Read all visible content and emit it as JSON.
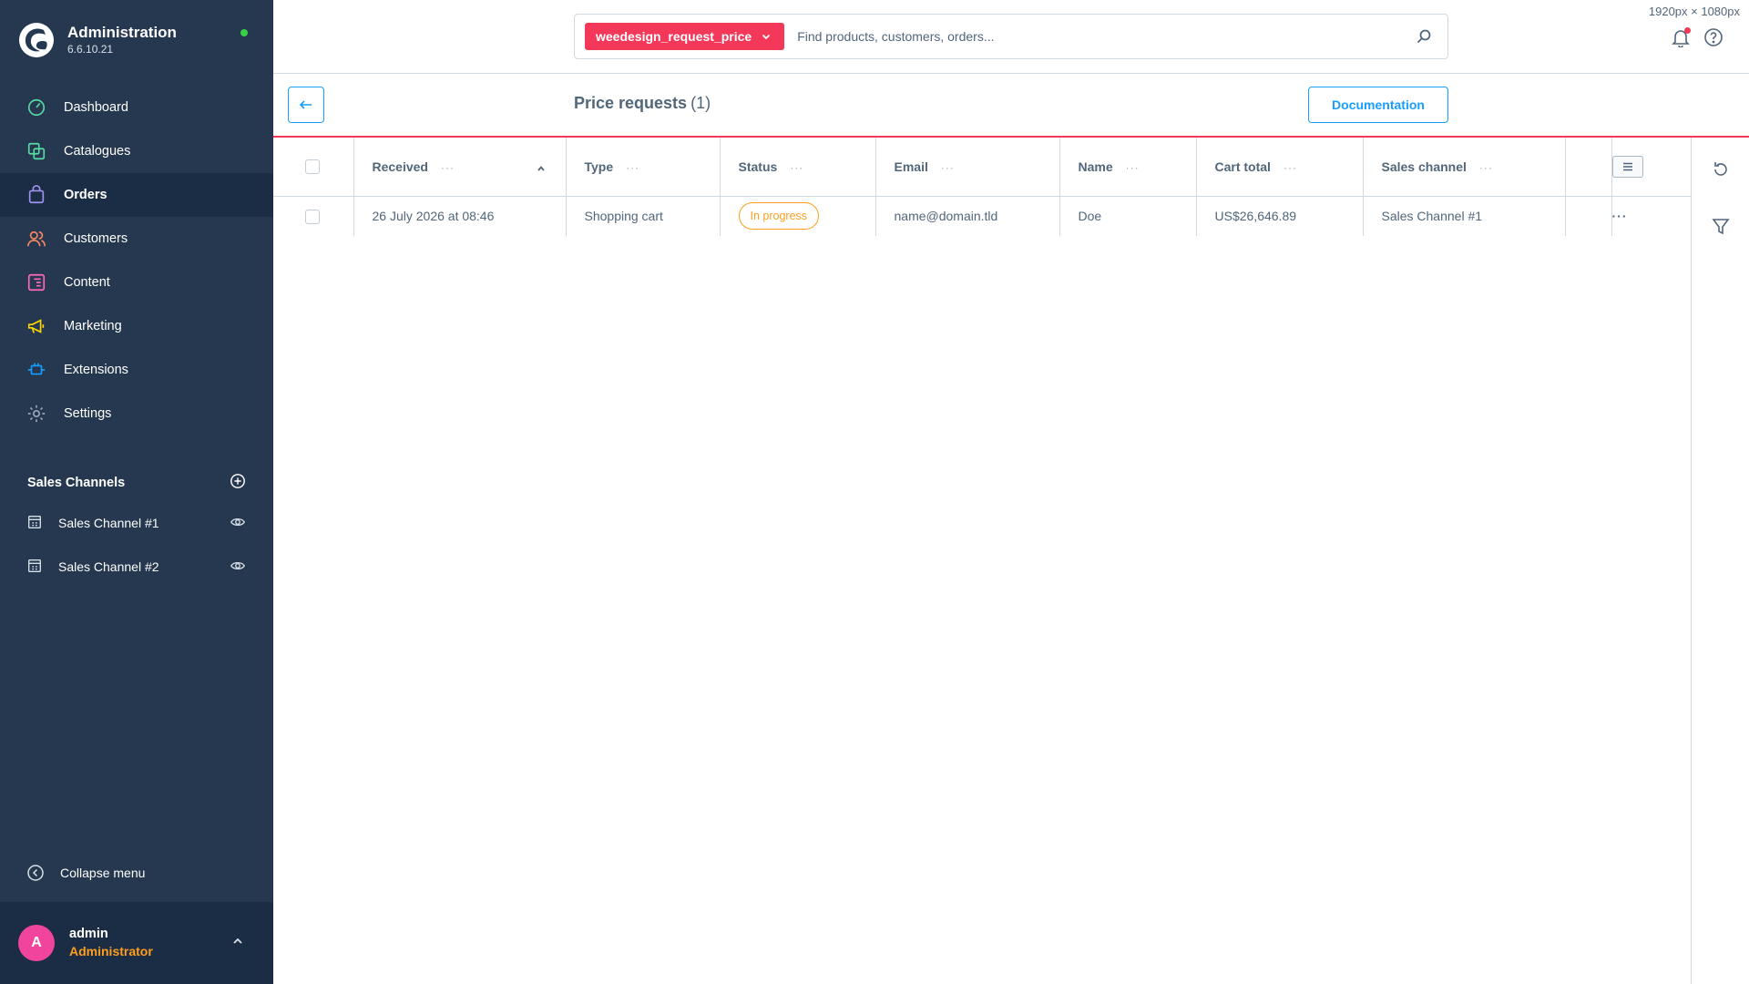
{
  "resolution": "1920px × 1080px",
  "brand": {
    "title": "Administration",
    "version": "6.6.10.21",
    "status_color": "#37d046"
  },
  "sidebar": {
    "items": [
      {
        "label": "Dashboard",
        "icon": "dashboard-icon",
        "color": "#57d9a3"
      },
      {
        "label": "Catalogues",
        "icon": "catalogues-icon",
        "color": "#57d9a3"
      },
      {
        "label": "Orders",
        "icon": "orders-icon",
        "color": "#a092f0",
        "active": true
      },
      {
        "label": "Customers",
        "icon": "customers-icon",
        "color": "#f88962"
      },
      {
        "label": "Content",
        "icon": "content-icon",
        "color": "#ff68b4"
      },
      {
        "label": "Marketing",
        "icon": "marketing-icon",
        "color": "#ffd700"
      },
      {
        "label": "Extensions",
        "icon": "extensions-icon",
        "color": "#189eff"
      },
      {
        "label": "Settings",
        "icon": "settings-icon",
        "color": "#9aa8b5"
      }
    ],
    "sales_channels_title": "Sales Channels",
    "sales_channels": [
      {
        "label": "Sales Channel #1"
      },
      {
        "label": "Sales Channel #2"
      }
    ],
    "collapse_label": "Collapse menu"
  },
  "user": {
    "initial": "A",
    "name": "admin",
    "role": "Administrator"
  },
  "search": {
    "entity_label": "weedesign_request_price",
    "placeholder": "Find products, customers, orders...",
    "accent": "#f3385a"
  },
  "smartbar": {
    "title": "Price requests",
    "count": "(1)",
    "documentation_label": "Documentation"
  },
  "grid": {
    "columns": [
      {
        "label": "Received",
        "dots": "···"
      },
      {
        "label": "Type",
        "dots": "···"
      },
      {
        "label": "Status",
        "dots": "···"
      },
      {
        "label": "Email",
        "dots": "···"
      },
      {
        "label": "Name",
        "dots": "···"
      },
      {
        "label": "Cart total",
        "dots": "···"
      },
      {
        "label": "Sales channel",
        "dots": "···"
      }
    ],
    "rows": [
      {
        "received": "26 July 2026 at 08:46",
        "type": "Shopping cart",
        "status": "In progress",
        "email": "name@domain.tld",
        "name": "Doe",
        "cart_total": "US$26,646.89",
        "sales_channel": "Sales Channel #1",
        "actions": "···"
      }
    ]
  }
}
